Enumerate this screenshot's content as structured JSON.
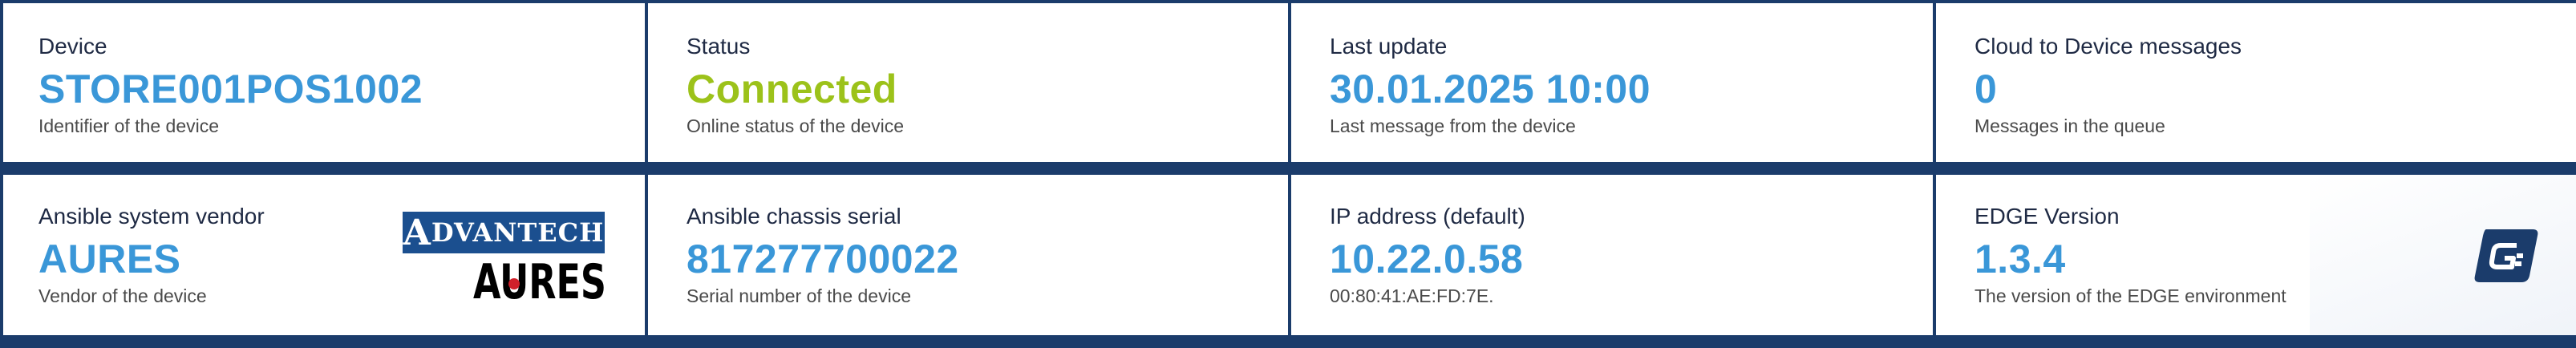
{
  "row1": [
    {
      "label": "Device",
      "value": "STORE001POS1002",
      "sub": "Identifier of the device"
    },
    {
      "label": "Status",
      "value": "Connected",
      "sub": "Online status of the device"
    },
    {
      "label": "Last update",
      "value": "30.01.2025 10:00",
      "sub": "Last message from the device"
    },
    {
      "label": "Cloud to Device messages",
      "value": "0",
      "sub": "Messages in the queue"
    }
  ],
  "row2": [
    {
      "label": "Ansible system vendor",
      "value": "AURES",
      "sub": "Vendor of the device"
    },
    {
      "label": "Ansible chassis serial",
      "value": "817277700022",
      "sub": "Serial number of the device"
    },
    {
      "label": "IP address (default)",
      "value": "10.22.0.58",
      "sub": "00:80:41:AE:FD:7E."
    },
    {
      "label": "EDGE Version",
      "value": "1.3.4",
      "sub": "The version of the EDGE environment"
    }
  ],
  "logos": {
    "advantech": "ADVANTECH",
    "aures": "AURES",
    "edge_badge_icon": "edge-logo-icon"
  },
  "colors": {
    "frame": "#1b3c6b",
    "value_blue": "#3a97d8",
    "status_green": "#9cc21a",
    "label": "#1f2a44"
  }
}
